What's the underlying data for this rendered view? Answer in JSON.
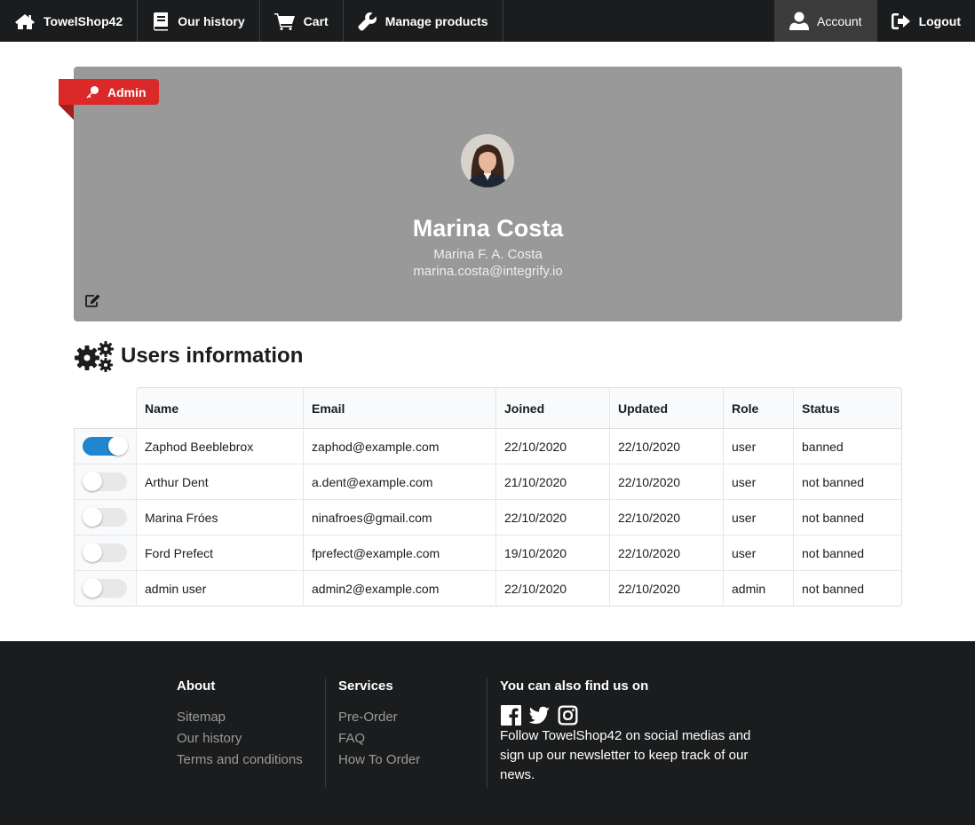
{
  "nav": {
    "brand": "TowelShop42",
    "history": "Our history",
    "cart": "Cart",
    "manage": "Manage products",
    "account": "Account",
    "logout": "Logout"
  },
  "profile": {
    "badge": "Admin",
    "name": "Marina Costa",
    "full_name": "Marina F. A. Costa",
    "email": "marina.costa@integrify.io"
  },
  "users": {
    "title": "Users information",
    "columns": [
      "Name",
      "Email",
      "Joined",
      "Updated",
      "Role",
      "Status"
    ],
    "rows": [
      {
        "toggled": true,
        "name": "Zaphod Beeblebrox",
        "email": "zaphod@example.com",
        "joined": "22/10/2020",
        "updated": "22/10/2020",
        "role": "user",
        "status": "banned"
      },
      {
        "toggled": false,
        "name": "Arthur Dent",
        "email": "a.dent@example.com",
        "joined": "21/10/2020",
        "updated": "22/10/2020",
        "role": "user",
        "status": "not banned"
      },
      {
        "toggled": false,
        "name": "Marina Fróes",
        "email": "ninafroes@gmail.com",
        "joined": "22/10/2020",
        "updated": "22/10/2020",
        "role": "user",
        "status": "not banned"
      },
      {
        "toggled": false,
        "name": "Ford Prefect",
        "email": "fprefect@example.com",
        "joined": "19/10/2020",
        "updated": "22/10/2020",
        "role": "user",
        "status": "not banned"
      },
      {
        "toggled": false,
        "name": "admin user",
        "email": "admin2@example.com",
        "joined": "22/10/2020",
        "updated": "22/10/2020",
        "role": "admin",
        "status": "not banned"
      }
    ]
  },
  "footer": {
    "about_title": "About",
    "about_links": [
      "Sitemap",
      "Our history",
      "Terms and conditions"
    ],
    "services_title": "Services",
    "services_links": [
      "Pre-Order",
      "FAQ",
      "How To Order"
    ],
    "social_title": "You can also find us on",
    "social_icons": [
      "facebook-icon",
      "twitter-icon",
      "instagram-icon"
    ],
    "social_text": "Follow TowelShop42 on social medias and sign up our newsletter to keep track of our news."
  },
  "colors": {
    "nav_bg": "#1b1c1d",
    "profile_bg": "#999999",
    "badge_red": "#db2828",
    "toggle_on": "#2185d0",
    "status_banned": "#db2828",
    "status_not_banned": "#0000cc"
  }
}
